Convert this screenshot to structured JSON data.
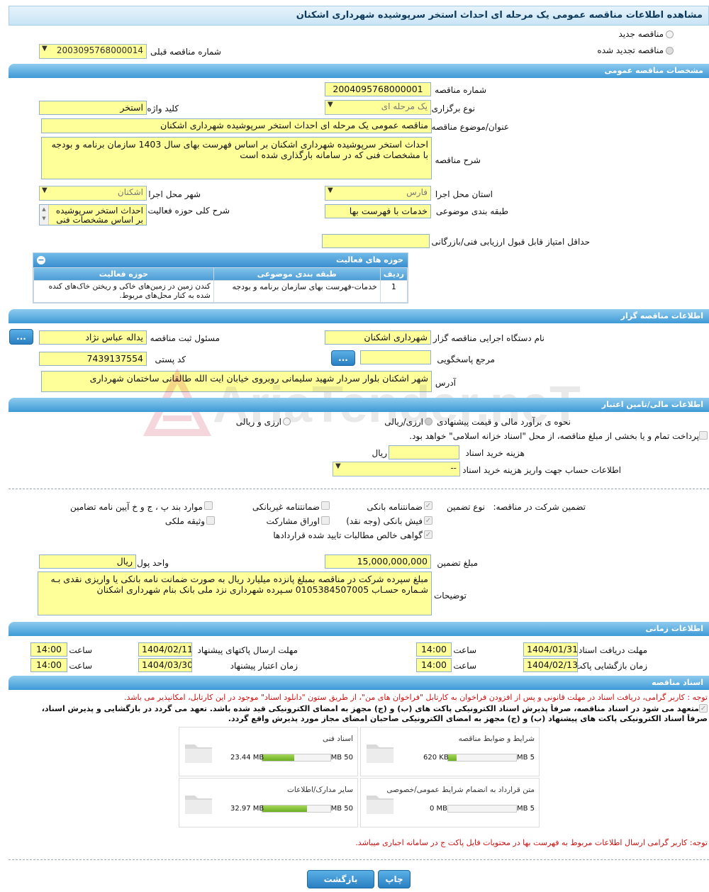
{
  "title": "مشاهده اطلاعات مناقصه عمومی یک مرحله ای احداث استخر سرپوشیده شهرداری اشکنان",
  "tender_type": {
    "new": "مناقصه جدید",
    "renewed": "مناقصه تجدید شده",
    "prev_label": "شماره مناقصه قبلی",
    "prev_value": "2003095768000014"
  },
  "general": {
    "section": "مشخصات مناقصه عمومی",
    "number_label": "شماره مناقصه",
    "number": "2004095768000001",
    "holding_label": "نوع برگزاری",
    "holding": "یک مرحله ای",
    "keyword_label": "کلید واژه",
    "keyword": "استخر",
    "subject_label": "عنوان/موضوع مناقصه",
    "subject": "مناقصه عمومی یک مرحله ای احداث استخر سرپوشیده شهرداری اشکنان",
    "desc_label": "شرح مناقصه",
    "desc": "احداث استخر سرپوشیده شهرداری اشکنان بر اساس فهرست بهای سال 1403 سازمان برنامه و بودجه با مشخصات فنی که در سامانه بارگذاری شده است",
    "province_label": "استان محل اجرا",
    "province": "فارس",
    "city_label": "شهر محل اجرا",
    "city": "اشکنان",
    "category_label": "طبقه بندی موضوعی",
    "category": "خدمات با فهرست بها",
    "activity_label": "شرح کلی حوزه فعالیت",
    "activity": "احداث استخر سرپوشیده بر اساس مشخصات فنی",
    "minscore_label": "حداقل امتیاز قابل قبول ارزیابی فنی/بازرگانی",
    "minscore": ""
  },
  "activities": {
    "title": "حوزه های فعالیت",
    "headers": [
      "ردیف",
      "طبقه بندی موضوعی",
      "حوزه فعالیت"
    ],
    "rows": [
      [
        "1",
        "خدمات-فهرست بهای سازمان برنامه و بودجه",
        "کندن زمین در زمین‌های خاکی و ریختن خاک‌های کنده شده به کنار محل‌های مربوط."
      ]
    ]
  },
  "organizer": {
    "section": "اطلاعات مناقصه گزار",
    "org_label": "نام دستگاه اجرایی مناقصه گزار",
    "org": "شهرداری اشکنان",
    "resp_label": "مسئول ثبت مناقصه",
    "resp": "یداله عباس نژاد",
    "ref_label": "مرجع پاسخگویی",
    "ref": "",
    "postal_label": "کد پستی",
    "postal": "7439137554",
    "addr_label": "آدرس",
    "addr": "شهر اشکنان بلوار سردار شهید سلیمانی روبروی خیابان ایت الله طالقانی ساختمان شهرداری",
    "more": "..."
  },
  "finance": {
    "section": "اطلاعات مالی/تامین اعتبار",
    "estimate_label": "نحوه ی برآورد مالی و قیمت پیشنهادی",
    "opt1": "ارزی/ریالی",
    "opt2": "ارزی و ریالی",
    "treasury": "پرداخت تمام و یا بخشی از مبلغ مناقصه، از محل \"اسناد خزانه اسلامی\" خواهد بود.",
    "fee_label": "هزینه خرید اسناد",
    "fee_unit": "ریال",
    "fee": "",
    "account_label": "اطلاعات حساب جهت واریز هزینه خرید اسناد",
    "account": "--"
  },
  "guarantee": {
    "company_label": "تضمین شرکت در مناقصه:",
    "type_label": "نوع تضمین",
    "bank": "ضمانتنامه بانکی",
    "nonbank": "ضمانتنامه غیربانکی",
    "items": "موارد بند پ ، ج و خ آیین نامه تضامین",
    "cash": "فیش بانکی (وجه نقد)",
    "bonds": "اوراق مشارکت",
    "property": "وثیقه ملکی",
    "claims": "گواهی خالص مطالبات تایید شده قراردادها",
    "amount_label": "مبلغ تضمین",
    "amount": "15,000,000,000",
    "unit_label": "واحد پول",
    "unit": "ریال",
    "notes_label": "توضیحات",
    "notes": "مبلغ سپرده شرکت در مناقصه  بمبلغ پانزده میلیارد ریال به صورت ضمانت نامه بانکی یا واریزی نقدی بـه  شـماره حسـاب 0105384507005  سـپرده شهرداری نزد ملی بانک بنام شهرداری اشکنان"
  },
  "timing": {
    "section": "اطلاعات زمانی",
    "receive_label": "مهلت دریافت اسناد",
    "receive_date": "1404/01/31",
    "receive_time": "14:00",
    "send_label": "مهلت ارسال پاکتهای پیشنهاد",
    "send_date": "1404/02/11",
    "send_time": "14:00",
    "open_label": "زمان بازگشایی پاکت ها",
    "open_date": "1404/02/13",
    "open_time": "14:00",
    "valid_label": "زمان اعتبار پیشنهاد",
    "valid_date": "1404/03/30",
    "valid_time": "14:00",
    "time_label": "ساعت"
  },
  "documents": {
    "section": "اسناد مناقصه",
    "note1": "توجه : کاربر گرامی، دریافت اسناد در مهلت قانونی و پس از افزودن فراخوان به کارتابل \"فراخوان های من\"، از طریق ستون \"دانلود اسناد\" موجود در این کارتابل، امکانپذیر می باشد.",
    "commit1": "متعهد می شود در اسناد مناقصه، صرفاً پذیرش اسناد الکترونیکی پاکت های (ب) و (ج) مجهز به امضای الکترونیکی قید شده باشد. تعهد می گردد در بازگشایی و پذیرش اسناد،",
    "commit2": "صرفاً اسناد الکترونیکی پاکت های پیشنهاد (ب) و (ج) مجهز به امضای الکترونیکی صاحبان امضای مجاز مورد پذیرش واقع گردد.",
    "files": [
      {
        "name": "شرایط و ضوابط مناقصه",
        "max": "5 MB",
        "size": "620 KB",
        "ratio": 0.12
      },
      {
        "name": "اسناد فنی",
        "max": "50 MB",
        "size": "23.44 MB",
        "ratio": 0.47
      },
      {
        "name": "متن قرارداد به انضمام شرایط عمومی/خصوصی",
        "max": "5 MB",
        "size": "0 MB",
        "ratio": 0.0
      },
      {
        "name": "سایر مدارک/اطلاعات",
        "max": "50 MB",
        "size": "32.97 MB",
        "ratio": 0.66
      }
    ],
    "note2": "توجه: کاربر گرامی ارسال اطلاعات مربوط به فهرست بها در محتویات فایل پاکت ج در سامانه اجباری میباشد."
  },
  "buttons": {
    "print": "چاپ",
    "back": "بازگشت"
  },
  "watermark": "AriaTender.neT"
}
